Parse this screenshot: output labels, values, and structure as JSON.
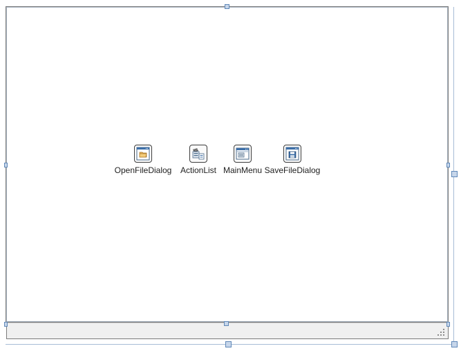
{
  "components": [
    {
      "label": "OpenFileDialog",
      "icon": "open-file-dialog-icon"
    },
    {
      "label": "ActionList",
      "icon": "action-list-icon"
    },
    {
      "label": "MainMenu",
      "icon": "main-menu-icon"
    },
    {
      "label": "SaveFileDialog",
      "icon": "save-file-dialog-icon"
    }
  ],
  "colors": {
    "handle_fill": "#c7d6ea",
    "handle_border": "#5f88b8",
    "form_border": "#7b7b7b",
    "status_bar": "#f0f0f0"
  }
}
